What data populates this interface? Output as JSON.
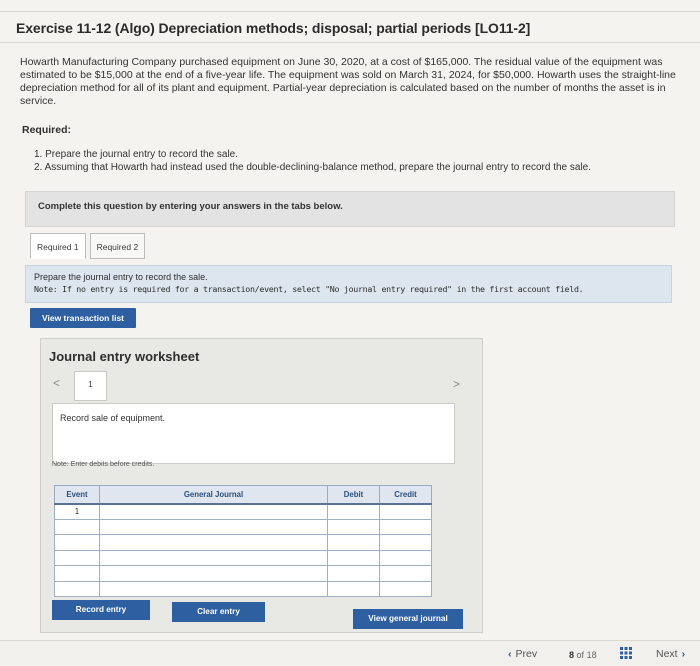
{
  "title": "Exercise 11-12 (Algo) Depreciation methods; disposal; partial periods [LO11-2]",
  "problem_text": "Howarth Manufacturing Company purchased equipment on June 30, 2020, at a cost of $165,000. The residual value of the equipment was estimated to be $15,000 at the end of a five-year life. The equipment was sold on March 31, 2024, for $50,000. Howarth uses the straight-line depreciation method for all of its plant and equipment. Partial-year depreciation is calculated based on the number of months the asset is in service.",
  "required_heading": "Required:",
  "requirements": [
    "1. Prepare the journal entry to record the sale.",
    "2. Assuming that Howarth had instead used the double-declining-balance method, prepare the journal entry to record the sale."
  ],
  "instruction_bar": "Complete this question by entering your answers in the tabs below.",
  "tabs": [
    "Required 1",
    "Required 2"
  ],
  "tab_panel": {
    "line1": "Prepare the journal entry to record the sale.",
    "line2": "Note: If no entry is required for a transaction/event, select \"No journal entry required\" in the first account field."
  },
  "view_transaction_list": "View transaction list",
  "worksheet": {
    "title": "Journal entry worksheet",
    "nav_prev": "<",
    "nav_tab": "1",
    "nav_next": ">",
    "description": "Record sale of equipment.",
    "note": "Note: Enter debits before credits.",
    "columns": [
      "Event",
      "General Journal",
      "Debit",
      "Credit"
    ],
    "rows": [
      {
        "event": "1",
        "account": "",
        "debit": "",
        "credit": ""
      },
      {
        "event": "",
        "account": "",
        "debit": "",
        "credit": ""
      },
      {
        "event": "",
        "account": "",
        "debit": "",
        "credit": ""
      },
      {
        "event": "",
        "account": "",
        "debit": "",
        "credit": ""
      },
      {
        "event": "",
        "account": "",
        "debit": "",
        "credit": ""
      },
      {
        "event": "",
        "account": "",
        "debit": "",
        "credit": ""
      }
    ],
    "record_entry": "Record entry",
    "clear_entry": "Clear entry",
    "view_general_journal": "View general journal"
  },
  "footer": {
    "prev": "Prev",
    "page_current": "8",
    "page_sep": "of",
    "page_total": "18",
    "next": "Next"
  },
  "colors": {
    "button_blue": "#2e5fa0",
    "tab_panel_bg": "#dde6ee",
    "table_header_bg": "#dfe6ef"
  }
}
